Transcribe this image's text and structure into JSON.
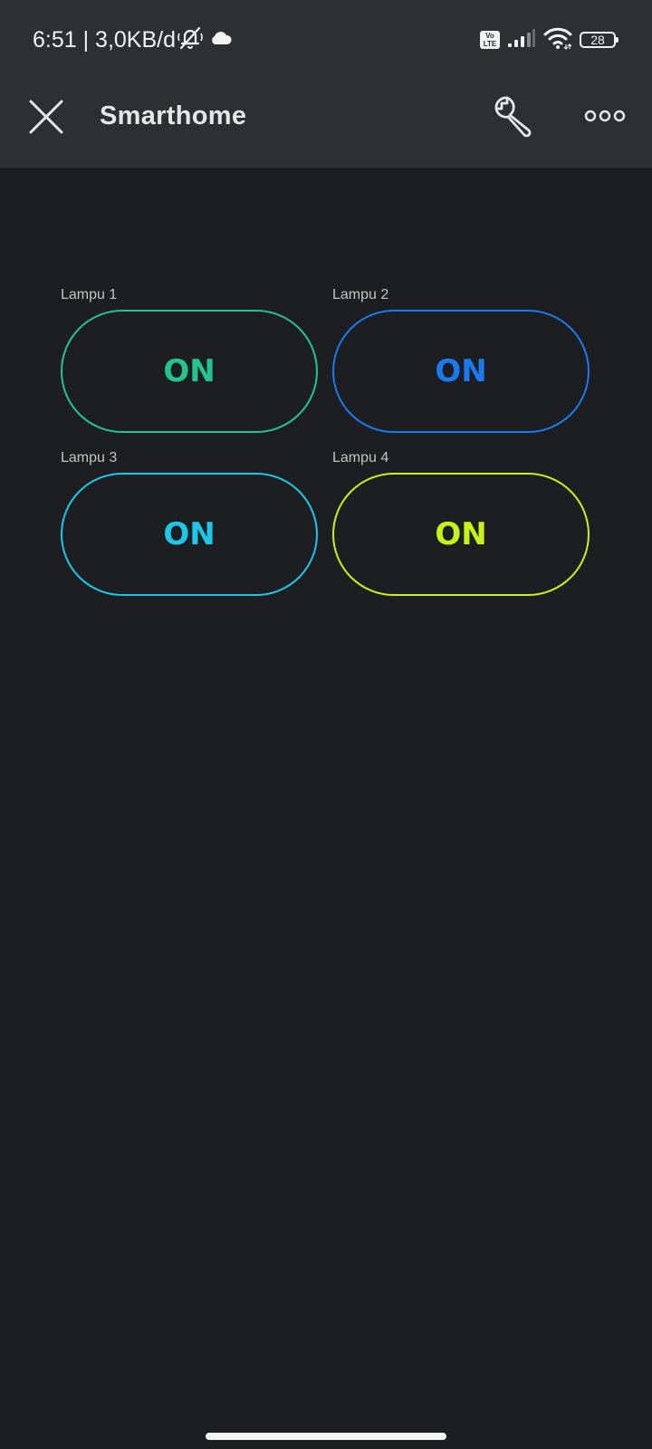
{
  "status_bar": {
    "time_text": "6:51 | 3,0KB/d",
    "volte_top": "Vo",
    "volte_bottom": "LTE",
    "battery_level": "28",
    "icons": [
      "mute-bell-icon",
      "cloud-icon",
      "volte-icon",
      "signal-icon",
      "wifi-icon",
      "battery-icon"
    ]
  },
  "app_bar": {
    "title": "Smarthome",
    "icons": [
      "close-icon",
      "wrench-icon",
      "more-icon"
    ]
  },
  "widgets": [
    {
      "label": "Lampu 1",
      "state": "ON",
      "color": "#23c48e"
    },
    {
      "label": "Lampu 2",
      "state": "ON",
      "color": "#1a7aee"
    },
    {
      "label": "Lampu 3",
      "state": "ON",
      "color": "#1ec6e8"
    },
    {
      "label": "Lampu 4",
      "state": "ON",
      "color": "#c7f21a"
    }
  ],
  "theme": {
    "background": "#1d1e21",
    "header": "#2e2f33"
  }
}
